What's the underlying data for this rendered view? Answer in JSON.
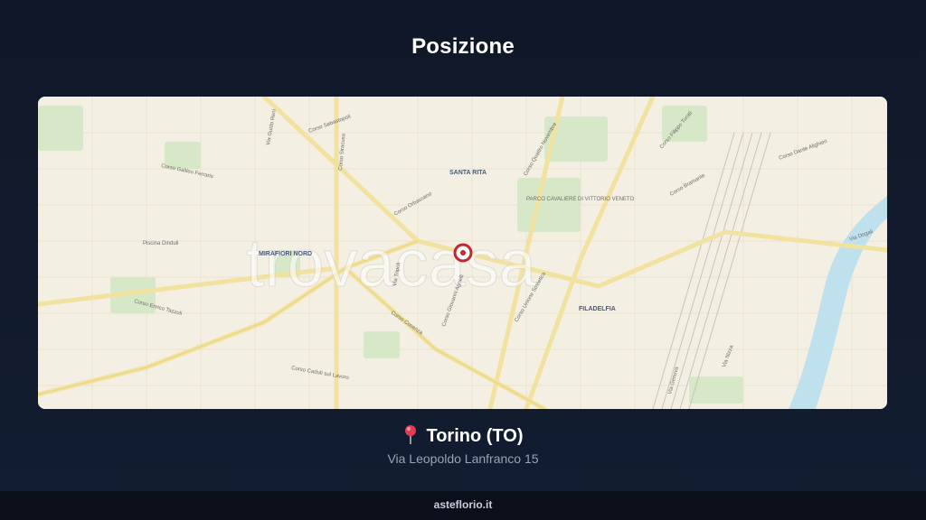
{
  "header": {
    "title": "Posizione"
  },
  "map": {
    "watermark": "trovacasa",
    "districts": [
      "SANTA RITA",
      "MIRAFIORI NORD",
      "FILADELFIA"
    ],
    "parks": [
      "PARCO CAVALIERE DI VITTORIO VENETO",
      "Piscina Dinduli"
    ],
    "streets": [
      "Corso Sebastopoli",
      "Corso Orbassano",
      "Corso Giovanni Agnelli",
      "Corso Cosenza",
      "Corso Unione Sovietica",
      "Corso Quattro Novembre",
      "Corso Filippo Turati",
      "Corso Bramante",
      "Corso Enrico Tazzoli",
      "Corso Caduti sul Lavoro",
      "Corso Siracusa",
      "Via Guido Reni",
      "Corso Galileo Ferraris",
      "Via Nizza",
      "Corso Dante Alighieri",
      "Via Tripoli",
      "Via Dogali",
      "Via Genova"
    ],
    "marker": "location-marker"
  },
  "location": {
    "city": "Torino (TO)",
    "address": "Via Leopoldo Lanfranco 15"
  },
  "footer": {
    "site": "asteflorio.it"
  },
  "colors": {
    "background": "#111a2c",
    "map_base": "#f4efe3",
    "road_major": "#f3e29a",
    "park": "#cfe6c0",
    "river": "#b9dff0",
    "marker": "#c1272d"
  }
}
